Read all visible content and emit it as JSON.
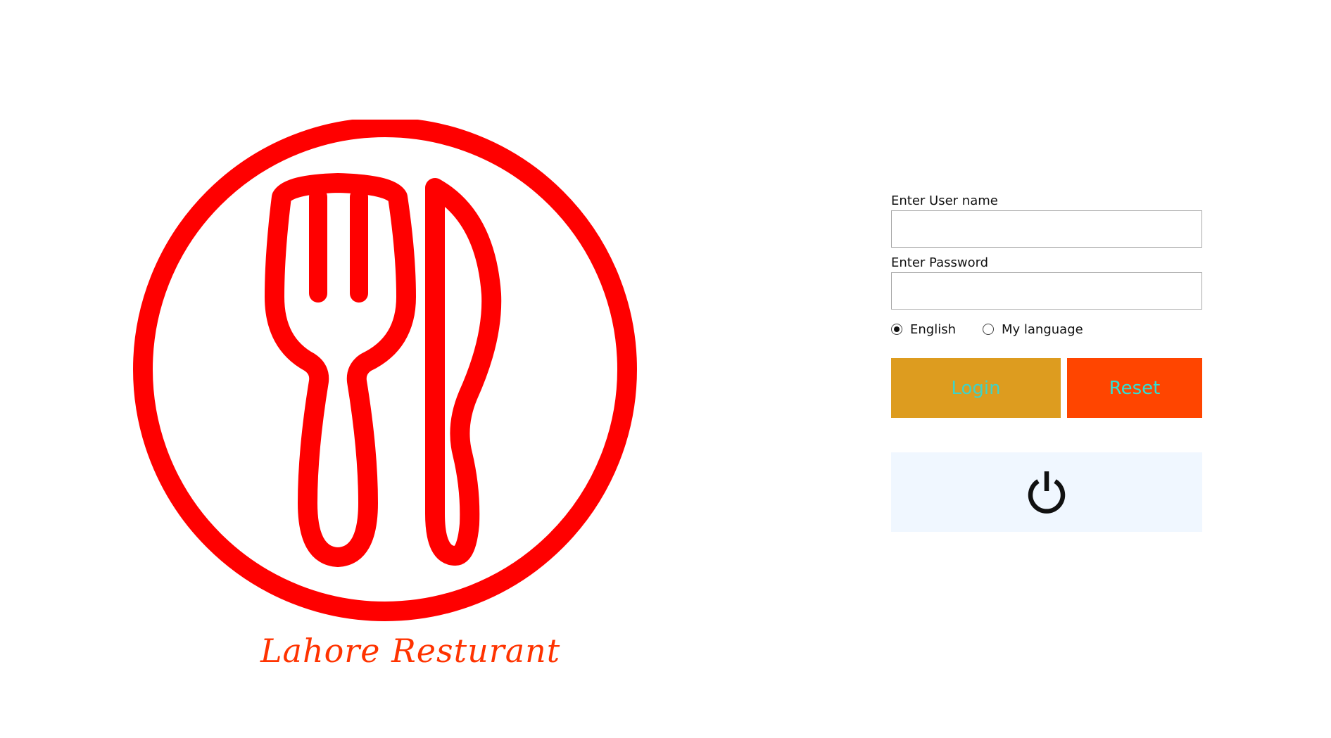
{
  "brand": {
    "name": "Lahore Resturant",
    "logo_icon": "fork-knife-plate-icon",
    "logo_color": "#ff0000",
    "name_color": "#ff3300"
  },
  "login_form": {
    "username_label": "Enter User name",
    "username_value": "",
    "password_label": "Enter Password",
    "password_value": "",
    "language_options": [
      {
        "label": "English",
        "selected": true
      },
      {
        "label": "My language",
        "selected": false
      }
    ],
    "login_button_label": "Login",
    "reset_button_label": "Reset",
    "login_button_color": "#dd9c1f",
    "reset_button_color": "#ff4500",
    "button_text_color": "#3ed3c8"
  },
  "power": {
    "icon": "power-icon",
    "panel_color": "#f0f7ff"
  }
}
